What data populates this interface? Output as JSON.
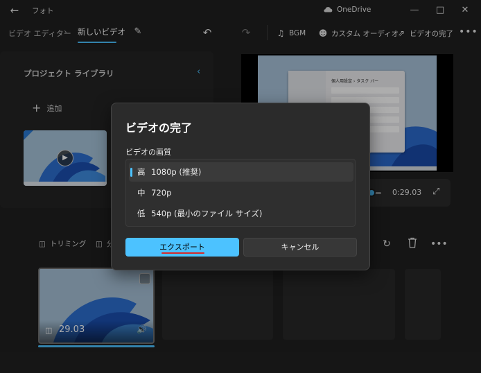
{
  "titlebar": {
    "back_icon": "back-arrow-icon",
    "app_title": "フォト",
    "cloud_label": "OneDrive",
    "minimize_icon": "minimize-icon",
    "maximize_icon": "maximize-icon",
    "close_icon": "close-icon"
  },
  "commandbar": {
    "breadcrumb_parent": "ビデオ エディター",
    "breadcrumb_current": "新しいビデオ",
    "bgm_label": "BGM",
    "custom_audio_label": "カスタム オーディオ",
    "finish_video_label": "ビデオの完了"
  },
  "library": {
    "title": "プロジェクト ライブラリ",
    "add_label": "追加"
  },
  "preview": {
    "time": "0:29.03",
    "screen_title": "個人用設定 › タスク バー"
  },
  "storyboard": {
    "trim_label": "トリミング",
    "split_label": "分",
    "clip_duration": "29.03",
    "clip_progress": 1.0
  },
  "dialog": {
    "title": "ビデオの完了",
    "quality_label": "ビデオの画質",
    "options": [
      {
        "level": "高",
        "text": "1080p (推奨)",
        "selected": true
      },
      {
        "level": "中",
        "text": "720p",
        "selected": false
      },
      {
        "level": "低",
        "text": "540p (最小のファイル サイズ)",
        "selected": false
      }
    ],
    "export_label": "エクスポート",
    "cancel_label": "キャンセル"
  },
  "colors": {
    "accent": "#4cc2ff",
    "background": "#202020",
    "dialog_bg": "#2b2b2b",
    "annotation_red": "#d62828"
  }
}
